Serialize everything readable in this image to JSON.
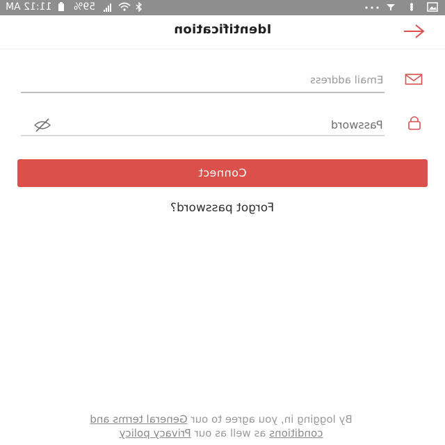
{
  "status_bar": {
    "time": "11:12 AM",
    "battery": "59%",
    "icons": [
      "signal-icon",
      "wifi-icon",
      "bluetooth-icon",
      "dots-icon",
      "notification-icon",
      "fan-icon",
      "image-icon"
    ]
  },
  "header": {
    "title": "Identification",
    "back_icon": "arrow-icon"
  },
  "form": {
    "email_placeholder": "Email address",
    "password_placeholder": "Password",
    "email_icon": "mail-icon",
    "password_icon": "lock-icon",
    "visibility_icon": "eye-off-icon"
  },
  "actions": {
    "connect_label": "Connect",
    "forgot_label": "Forgot password?"
  },
  "legal": {
    "prefix": "By logging in, you agree to our ",
    "terms_link_line1": "General terms and",
    "terms_link_line2": "conditions",
    "middle": " as well as our ",
    "privacy_link": "Privacy policy"
  },
  "colors": {
    "accent": "#db504a",
    "status_bar": "#8e8e8e",
    "placeholder": "#9a9a9a"
  }
}
